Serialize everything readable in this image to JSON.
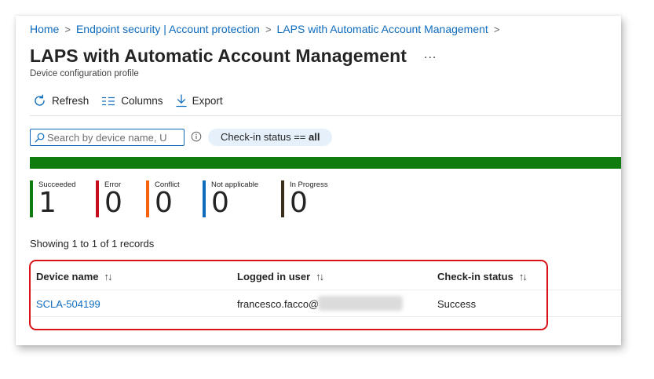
{
  "breadcrumb": [
    {
      "label": "Home"
    },
    {
      "label": "Endpoint security | Account protection"
    },
    {
      "label": "LAPS with Automatic Account Management"
    }
  ],
  "breadcrumb_separator": ">",
  "page": {
    "title": "LAPS with Automatic Account Management",
    "more": "...",
    "subtitle": "Device configuration profile"
  },
  "toolbar": {
    "refresh": "Refresh",
    "columns": "Columns",
    "export": "Export"
  },
  "search": {
    "value": "",
    "placeholder": "Search by device name, U"
  },
  "filter": {
    "prefix": "Check-in status == ",
    "value": "all"
  },
  "progress": {
    "succeeded_fraction": 1.0,
    "color": "#107c10"
  },
  "stats": [
    {
      "label": "Succeeded",
      "value": "1",
      "color": "#107c10"
    },
    {
      "label": "Error",
      "value": "0",
      "color": "#c50f1f"
    },
    {
      "label": "Conflict",
      "value": "0",
      "color": "#f7630c"
    },
    {
      "label": "Not applicable",
      "value": "0",
      "color": "#0f6cbd"
    },
    {
      "label": "In Progress",
      "value": "0",
      "color": "#3b2e1a"
    }
  ],
  "records_text": "Showing 1 to 1 of 1 records",
  "table": {
    "columns": [
      "Device name",
      "Logged in user",
      "Check-in status"
    ],
    "sort_glyph": "↑↓",
    "rows": [
      {
        "device": "SCLA-504199",
        "user": "francesco.facco@",
        "status": "Success"
      }
    ]
  },
  "colors": {
    "link": "#0f6cbd",
    "accent": "#0f6cbd",
    "highlight": "#d9121a"
  }
}
